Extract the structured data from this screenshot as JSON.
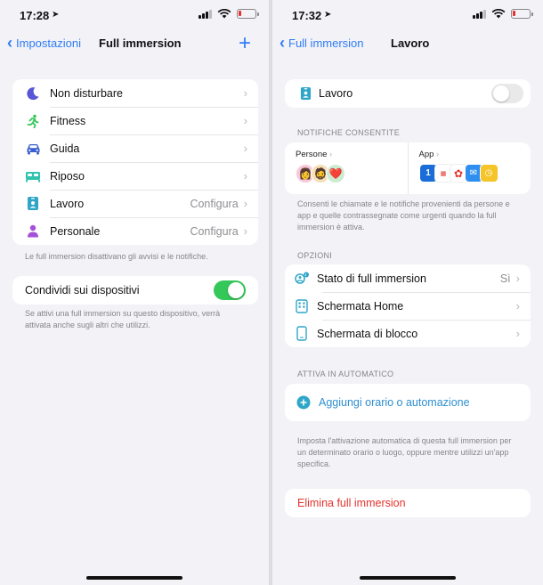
{
  "left": {
    "status": {
      "time": "17:28"
    },
    "nav": {
      "back_label": "Impostazioni",
      "title": "Full immersion"
    },
    "focus_items": [
      {
        "icon": "moon-icon",
        "color": "#5856d6",
        "label": "Non disturbare",
        "value": ""
      },
      {
        "icon": "running-person-icon",
        "color": "#34c759",
        "label": "Fitness",
        "value": ""
      },
      {
        "icon": "car-icon",
        "color": "#3a5fd0",
        "label": "Guida",
        "value": ""
      },
      {
        "icon": "bed-icon",
        "color": "#30c4b0",
        "label": "Riposo",
        "value": ""
      },
      {
        "icon": "id-badge-icon",
        "color": "#2fa6c8",
        "label": "Lavoro",
        "value": "Configura"
      },
      {
        "icon": "person-icon",
        "color": "#a550d8",
        "label": "Personale",
        "value": "Configura"
      }
    ],
    "focus_footnote": "Le full immersion disattivano gli avvisi e le notifiche.",
    "share": {
      "label": "Condividi sui dispositivi",
      "enabled": true
    },
    "share_footnote": "Se attivi una full immersion su questo dispositivo, verrà attivata anche sugli altri che utilizzi."
  },
  "right": {
    "status": {
      "time": "17:32"
    },
    "nav": {
      "back_label": "Full immersion",
      "title": "Lavoro"
    },
    "focus": {
      "label": "Lavoro",
      "enabled": false
    },
    "notif_header": "NOTIFICHE CONSENTITE",
    "people_label": "Persone",
    "apps_label": "App",
    "notif_footnote": "Consenti le chiamate e le notifiche provenienti da persone e app e quelle contrassegnate come urgenti quando la full immersion è attiva.",
    "options_header": "OPZIONI",
    "options": [
      {
        "icon": "focus-status-icon",
        "label": "Stato di full immersion",
        "value": "Sì"
      },
      {
        "icon": "home-screen-icon",
        "label": "Schermata Home",
        "value": ""
      },
      {
        "icon": "lock-screen-icon",
        "label": "Schermata di blocco",
        "value": ""
      }
    ],
    "auto_header": "ATTIVA IN AUTOMATICO",
    "add_automation": "Aggiungi orario o automazione",
    "auto_footnote": "Imposta l'attivazione automatica di questa full immersion per un determinato orario o luogo, oppure mentre utilizzi un'app specifica.",
    "delete_label": "Elimina full immersion"
  },
  "colors": {
    "accent": "#2f7cf6",
    "toggle_on": "#34c759",
    "destructive": "#e5322d",
    "teal": "#2fa6c8"
  }
}
